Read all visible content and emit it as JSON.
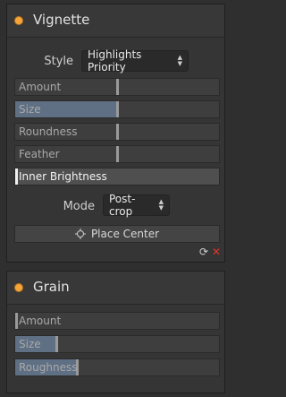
{
  "vignette": {
    "title": "Vignette",
    "style_label": "Style",
    "style_value": "Highlights Priority",
    "sliders": [
      {
        "label": "Amount",
        "value": 0.5
      },
      {
        "label": "Size",
        "value": 0.5
      },
      {
        "label": "Roundness",
        "value": 0.5
      },
      {
        "label": "Feather",
        "value": 0.5
      },
      {
        "label": "Inner Brightness",
        "value": 0.0
      }
    ],
    "mode_label": "Mode",
    "mode_value": "Post-crop",
    "place_center_label": "Place Center",
    "icons": [
      "reset-icon",
      "close-icon"
    ]
  },
  "grain": {
    "title": "Grain",
    "sliders": [
      {
        "label": "Amount",
        "value": 0.0
      },
      {
        "label": "Size",
        "value": 0.2
      },
      {
        "label": "Roughness",
        "value": 0.3
      }
    ]
  },
  "colors": {
    "accent_dot": "#f3a53a",
    "slider_fill": "#5f6f84",
    "close": "#e0362b"
  }
}
